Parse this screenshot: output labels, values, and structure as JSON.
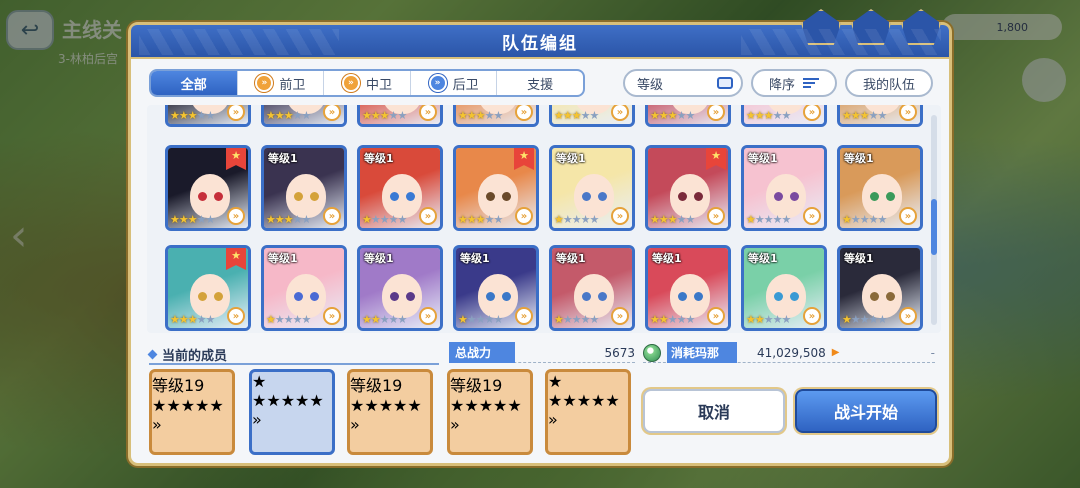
{
  "background": {
    "back_icon": "back-arrow-icon",
    "title": "主线关",
    "subtitle": "3-林柏后宫",
    "currency": "1,800"
  },
  "dialog": {
    "title": "队伍编组"
  },
  "tabs": [
    {
      "label": "全部",
      "active": true,
      "icon": ""
    },
    {
      "label": "前卫",
      "active": false,
      "icon": "role-icon-front"
    },
    {
      "label": "中卫",
      "active": false,
      "icon": "role-icon-middle"
    },
    {
      "label": "后卫",
      "active": false,
      "icon": "role-icon-back"
    },
    {
      "label": "支援",
      "active": false,
      "icon": ""
    }
  ],
  "sort": {
    "level_label": "等级",
    "order_label": "降序",
    "my_team_label": "我的队伍"
  },
  "roster": {
    "rows": [
      [
        {
          "level": "",
          "stars": 3,
          "flag": true,
          "colors": [
            "#1a1a2a",
            "#c62f3a"
          ]
        },
        {
          "level": "等级1",
          "stars": 3,
          "flag": false,
          "colors": [
            "#3a3350",
            "#d4a23a"
          ]
        },
        {
          "level": "等级1",
          "stars": 1,
          "flag": false,
          "colors": [
            "#d94a3a",
            "#3a7ad4"
          ]
        },
        {
          "level": "",
          "stars": 3,
          "flag": true,
          "colors": [
            "#e8884a",
            "#6a4a2a"
          ]
        },
        {
          "level": "等级1",
          "stars": 1,
          "flag": false,
          "colors": [
            "#f5e6a8",
            "#4a78c8"
          ]
        },
        {
          "level": "",
          "stars": 3,
          "flag": true,
          "colors": [
            "#c44a5a",
            "#7a2a3a"
          ]
        },
        {
          "level": "等级1",
          "stars": 1,
          "flag": false,
          "colors": [
            "#f6c2d0",
            "#7a4aa0"
          ]
        },
        {
          "level": "等级1",
          "stars": 1,
          "flag": false,
          "colors": [
            "#d99a5a",
            "#3a9a5a"
          ]
        }
      ],
      [
        {
          "level": "",
          "stars": 3,
          "flag": true,
          "colors": [
            "#4ab0b0",
            "#d4a23a"
          ]
        },
        {
          "level": "等级1",
          "stars": 1,
          "flag": false,
          "colors": [
            "#f6b8c8",
            "#4a6ad4"
          ]
        },
        {
          "level": "等级1",
          "stars": 2,
          "flag": false,
          "colors": [
            "#a07ac8",
            "#5a3a8a"
          ]
        },
        {
          "level": "等级1",
          "stars": 1,
          "flag": false,
          "colors": [
            "#3a3a8a",
            "#3a78c8"
          ]
        },
        {
          "level": "等级1",
          "stars": 1,
          "flag": false,
          "colors": [
            "#c45a6a",
            "#4a78c8"
          ]
        },
        {
          "level": "等级1",
          "stars": 2,
          "flag": false,
          "colors": [
            "#d94a5a",
            "#3a78c8"
          ]
        },
        {
          "level": "等级1",
          "stars": 2,
          "flag": false,
          "colors": [
            "#7ad0a8",
            "#3a9ad4"
          ]
        },
        {
          "level": "等级1",
          "stars": 1,
          "flag": false,
          "colors": [
            "#2a2a3a",
            "#8a6a3a"
          ]
        }
      ]
    ]
  },
  "members": {
    "label": "当前的成员",
    "list": [
      {
        "level": "等级19",
        "stars": 3,
        "flag": false,
        "colors": [
          "#d94a5a",
          "#3a78c8"
        ]
      },
      {
        "level": "",
        "stars": 3,
        "flag": true,
        "colors": [
          "#f6b8c8",
          "#d43a5a"
        ]
      },
      {
        "level": "等级19",
        "stars": 3,
        "flag": false,
        "colors": [
          "#e8c86a",
          "#7a4a2a"
        ]
      },
      {
        "level": "等级19",
        "stars": 3,
        "flag": false,
        "colors": [
          "#e86a3a",
          "#3a3a8a"
        ]
      },
      {
        "level": "",
        "stars": 4,
        "flag": true,
        "colors": [
          "#f0a23a",
          "#2f9a9a"
        ]
      }
    ]
  },
  "stats": {
    "power_label": "总战力",
    "power_value": "5673",
    "cost_label": "消耗玛那",
    "cost_value": "41,029,508",
    "cost_extra": "-"
  },
  "buttons": {
    "cancel": "取消",
    "start": "战斗开始"
  },
  "colors": {
    "accent": "#2f63c2",
    "gold_border": "#d8bf7a",
    "star": "#f5c431"
  }
}
